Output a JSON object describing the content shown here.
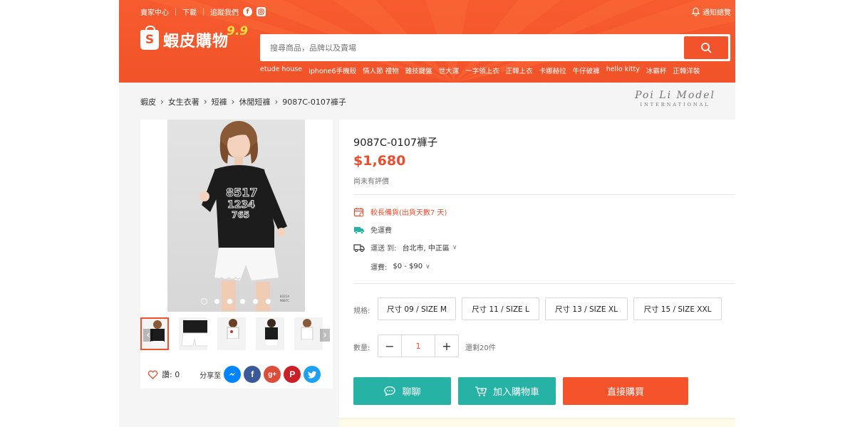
{
  "colors": {
    "brand": "#f2532a",
    "price": "#ee4d2d",
    "teal": "#26b3a5"
  },
  "header": {
    "topbar": {
      "seller_center": "賣家中心",
      "download": "下載",
      "follow": "追蹤我們",
      "notifications": "通知總覽"
    },
    "logo_text": "蝦皮購物",
    "logo_badge": "9.9",
    "search": {
      "placeholder": "搜尋商品，品牌以及賣場"
    },
    "keywords": [
      "etude house",
      "iphone6手機殼",
      "情人節 禮物",
      "雞技鍵盤",
      "世大運",
      "一字領上衣",
      "正韓上衣",
      "卡娜赫拉",
      "牛仔破褲",
      "hello kitty",
      "冰霸杯",
      "正韓洋裝"
    ]
  },
  "breadcrumb": [
    "蝦皮",
    "女生衣著",
    "短褲",
    "休閒短褲",
    "9087C-0107褲子"
  ],
  "brandmark": {
    "line1": "Poi Li Model",
    "line2": "INTERNATIONAL"
  },
  "gallery": {
    "image_code": [
      "8321A",
      "9087C"
    ],
    "dots": 6,
    "active_dot": 0,
    "likes_label": "讚: 0",
    "share_label": "分享至"
  },
  "product": {
    "title": "9087C-0107褲子",
    "price": "$1,680",
    "rating_text": "尚未有評價",
    "preorder": "較長備貨(出貨天數7 天)",
    "free_shipping": "免運費",
    "ship_to_label": "運送 到:",
    "ship_to_value": "台北市, 中正區",
    "ship_fee_label": "運費:",
    "ship_fee_value": "$0 - $90",
    "size_label": "規格:",
    "sizes": [
      "尺寸 09 / SIZE M",
      "尺寸 11 / SIZE L",
      "尺寸 13 / SIZE XL",
      "尺寸 15 / SIZE XXL"
    ],
    "qty_label": "數量:",
    "qty_minus": "−",
    "qty_value": "1",
    "qty_plus": "+",
    "stock_text": "還剩20件"
  },
  "actions": {
    "chat": "聊聊",
    "add_to_cart": "加入購物車",
    "buy_now": "直接購買"
  },
  "icons": {
    "bell": "bell-icon",
    "facebook": "facebook-icon",
    "instagram": "instagram-icon",
    "search": "search-icon",
    "calendar": "calendar-icon",
    "truck_free": "free-shipping-icon",
    "truck": "truck-icon",
    "heart": "heart-icon",
    "messenger": "messenger-icon",
    "google_plus": "google-plus-icon",
    "pinterest": "pinterest-icon",
    "twitter": "twitter-icon"
  }
}
